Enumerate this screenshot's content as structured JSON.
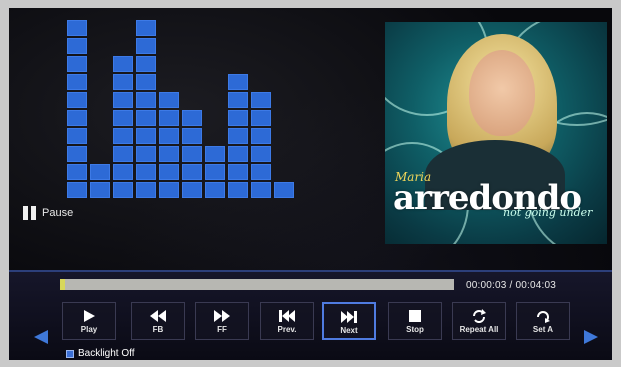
{
  "visualizer": {
    "levels": [
      10,
      2,
      8,
      10,
      6,
      5,
      3,
      7,
      6,
      1
    ],
    "max_levels": 10,
    "color": "#2d6ad6"
  },
  "status": {
    "icon": "pause-icon",
    "label": "Pause"
  },
  "album_art": {
    "artist_first": "Maria",
    "artist_last": "arredondo",
    "subtitle": "not going under"
  },
  "playback": {
    "elapsed": "00:00:03",
    "separator": "/",
    "total": "00:04:03",
    "progress": 0.012
  },
  "controls": [
    {
      "id": "play",
      "label": "Play",
      "icon": "play-icon"
    },
    {
      "id": "fb",
      "label": "FB",
      "icon": "fast-backward-icon"
    },
    {
      "id": "ff",
      "label": "FF",
      "icon": "fast-forward-icon"
    },
    {
      "id": "prev",
      "label": "Prev.",
      "icon": "previous-track-icon"
    },
    {
      "id": "next",
      "label": "Next",
      "icon": "next-track-icon",
      "selected": true
    },
    {
      "id": "stop",
      "label": "Stop",
      "icon": "stop-icon"
    },
    {
      "id": "repeat",
      "label": "Repeat All",
      "icon": "repeat-icon"
    },
    {
      "id": "seta",
      "label": "Set A",
      "icon": "set-a-icon"
    }
  ],
  "footer": {
    "backlight_label": "Backlight Off"
  },
  "colors": {
    "accent": "#3f78d9",
    "progress_fill": "#d7d75a",
    "progress_track": "#b7b7b2"
  }
}
